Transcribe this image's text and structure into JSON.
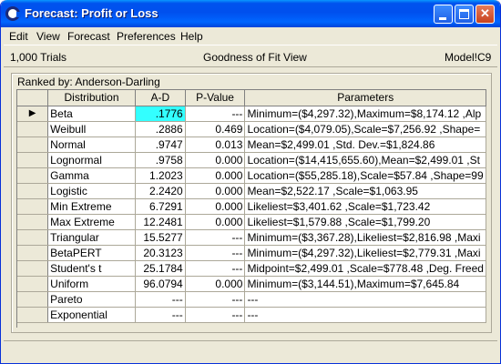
{
  "window": {
    "title": "Forecast: Profit or Loss",
    "controls": {
      "minimize": "",
      "maximize": "",
      "close": "✕"
    }
  },
  "menu": [
    "Edit",
    "View",
    "Forecast",
    "Preferences",
    "Help"
  ],
  "info": {
    "trials": "1,000 Trials",
    "view": "Goodness of Fit View",
    "cell": "Model!C9"
  },
  "ranked_by": "Ranked by: Anderson-Darling",
  "table": {
    "columns": [
      "Distribution",
      "A-D",
      "P-Value",
      "Parameters"
    ],
    "selected_row": 0,
    "selected_marker": "▶",
    "rows": [
      {
        "distribution": "Beta",
        "ad": ".1776",
        "pvalue": "---",
        "params": "Minimum=($4,297.32),Maximum=$8,174.12 ,Alp"
      },
      {
        "distribution": "Weibull",
        "ad": ".2886",
        "pvalue": "0.469",
        "params": "Location=($4,079.05),Scale=$7,256.92 ,Shape="
      },
      {
        "distribution": "Normal",
        "ad": ".9747",
        "pvalue": "0.013",
        "params": "Mean=$2,499.01 ,Std. Dev.=$1,824.86"
      },
      {
        "distribution": "Lognormal",
        "ad": ".9758",
        "pvalue": "0.000",
        "params": "Location=($14,415,655.60),Mean=$2,499.01 ,St"
      },
      {
        "distribution": "Gamma",
        "ad": "1.2023",
        "pvalue": "0.000",
        "params": "Location=($55,285.18),Scale=$57.84 ,Shape=99"
      },
      {
        "distribution": "Logistic",
        "ad": "2.2420",
        "pvalue": "0.000",
        "params": "Mean=$2,522.17 ,Scale=$1,063.95"
      },
      {
        "distribution": "Min Extreme",
        "ad": "6.7291",
        "pvalue": "0.000",
        "params": "Likeliest=$3,401.62 ,Scale=$1,723.42"
      },
      {
        "distribution": "Max Extreme",
        "ad": "12.2481",
        "pvalue": "0.000",
        "params": "Likeliest=$1,579.88 ,Scale=$1,799.20"
      },
      {
        "distribution": "Triangular",
        "ad": "15.5277",
        "pvalue": "---",
        "params": "Minimum=($3,367.28),Likeliest=$2,816.98 ,Maxi"
      },
      {
        "distribution": "BetaPERT",
        "ad": "20.3123",
        "pvalue": "---",
        "params": "Minimum=($4,297.32),Likeliest=$2,779.31 ,Maxi"
      },
      {
        "distribution": "Student's t",
        "ad": "25.1784",
        "pvalue": "---",
        "params": "Midpoint=$2,499.01 ,Scale=$778.48 ,Deg. Freed"
      },
      {
        "distribution": "Uniform",
        "ad": "96.0794",
        "pvalue": "0.000",
        "params": "Minimum=($3,144.51),Maximum=$7,645.84"
      },
      {
        "distribution": "Pareto",
        "ad": "---",
        "pvalue": "---",
        "params": "---"
      },
      {
        "distribution": "Exponential",
        "ad": "---",
        "pvalue": "---",
        "params": "---"
      }
    ]
  },
  "colors": {
    "title_bar": "#0054e3",
    "highlight_cell": "#33ffff",
    "window_bg": "#ece9d8"
  },
  "icons": {
    "app": "crystal-ball-icon",
    "minimize": "minimize-icon",
    "maximize": "maximize-icon",
    "close": "close-icon",
    "row_pointer": "row-pointer-icon"
  }
}
